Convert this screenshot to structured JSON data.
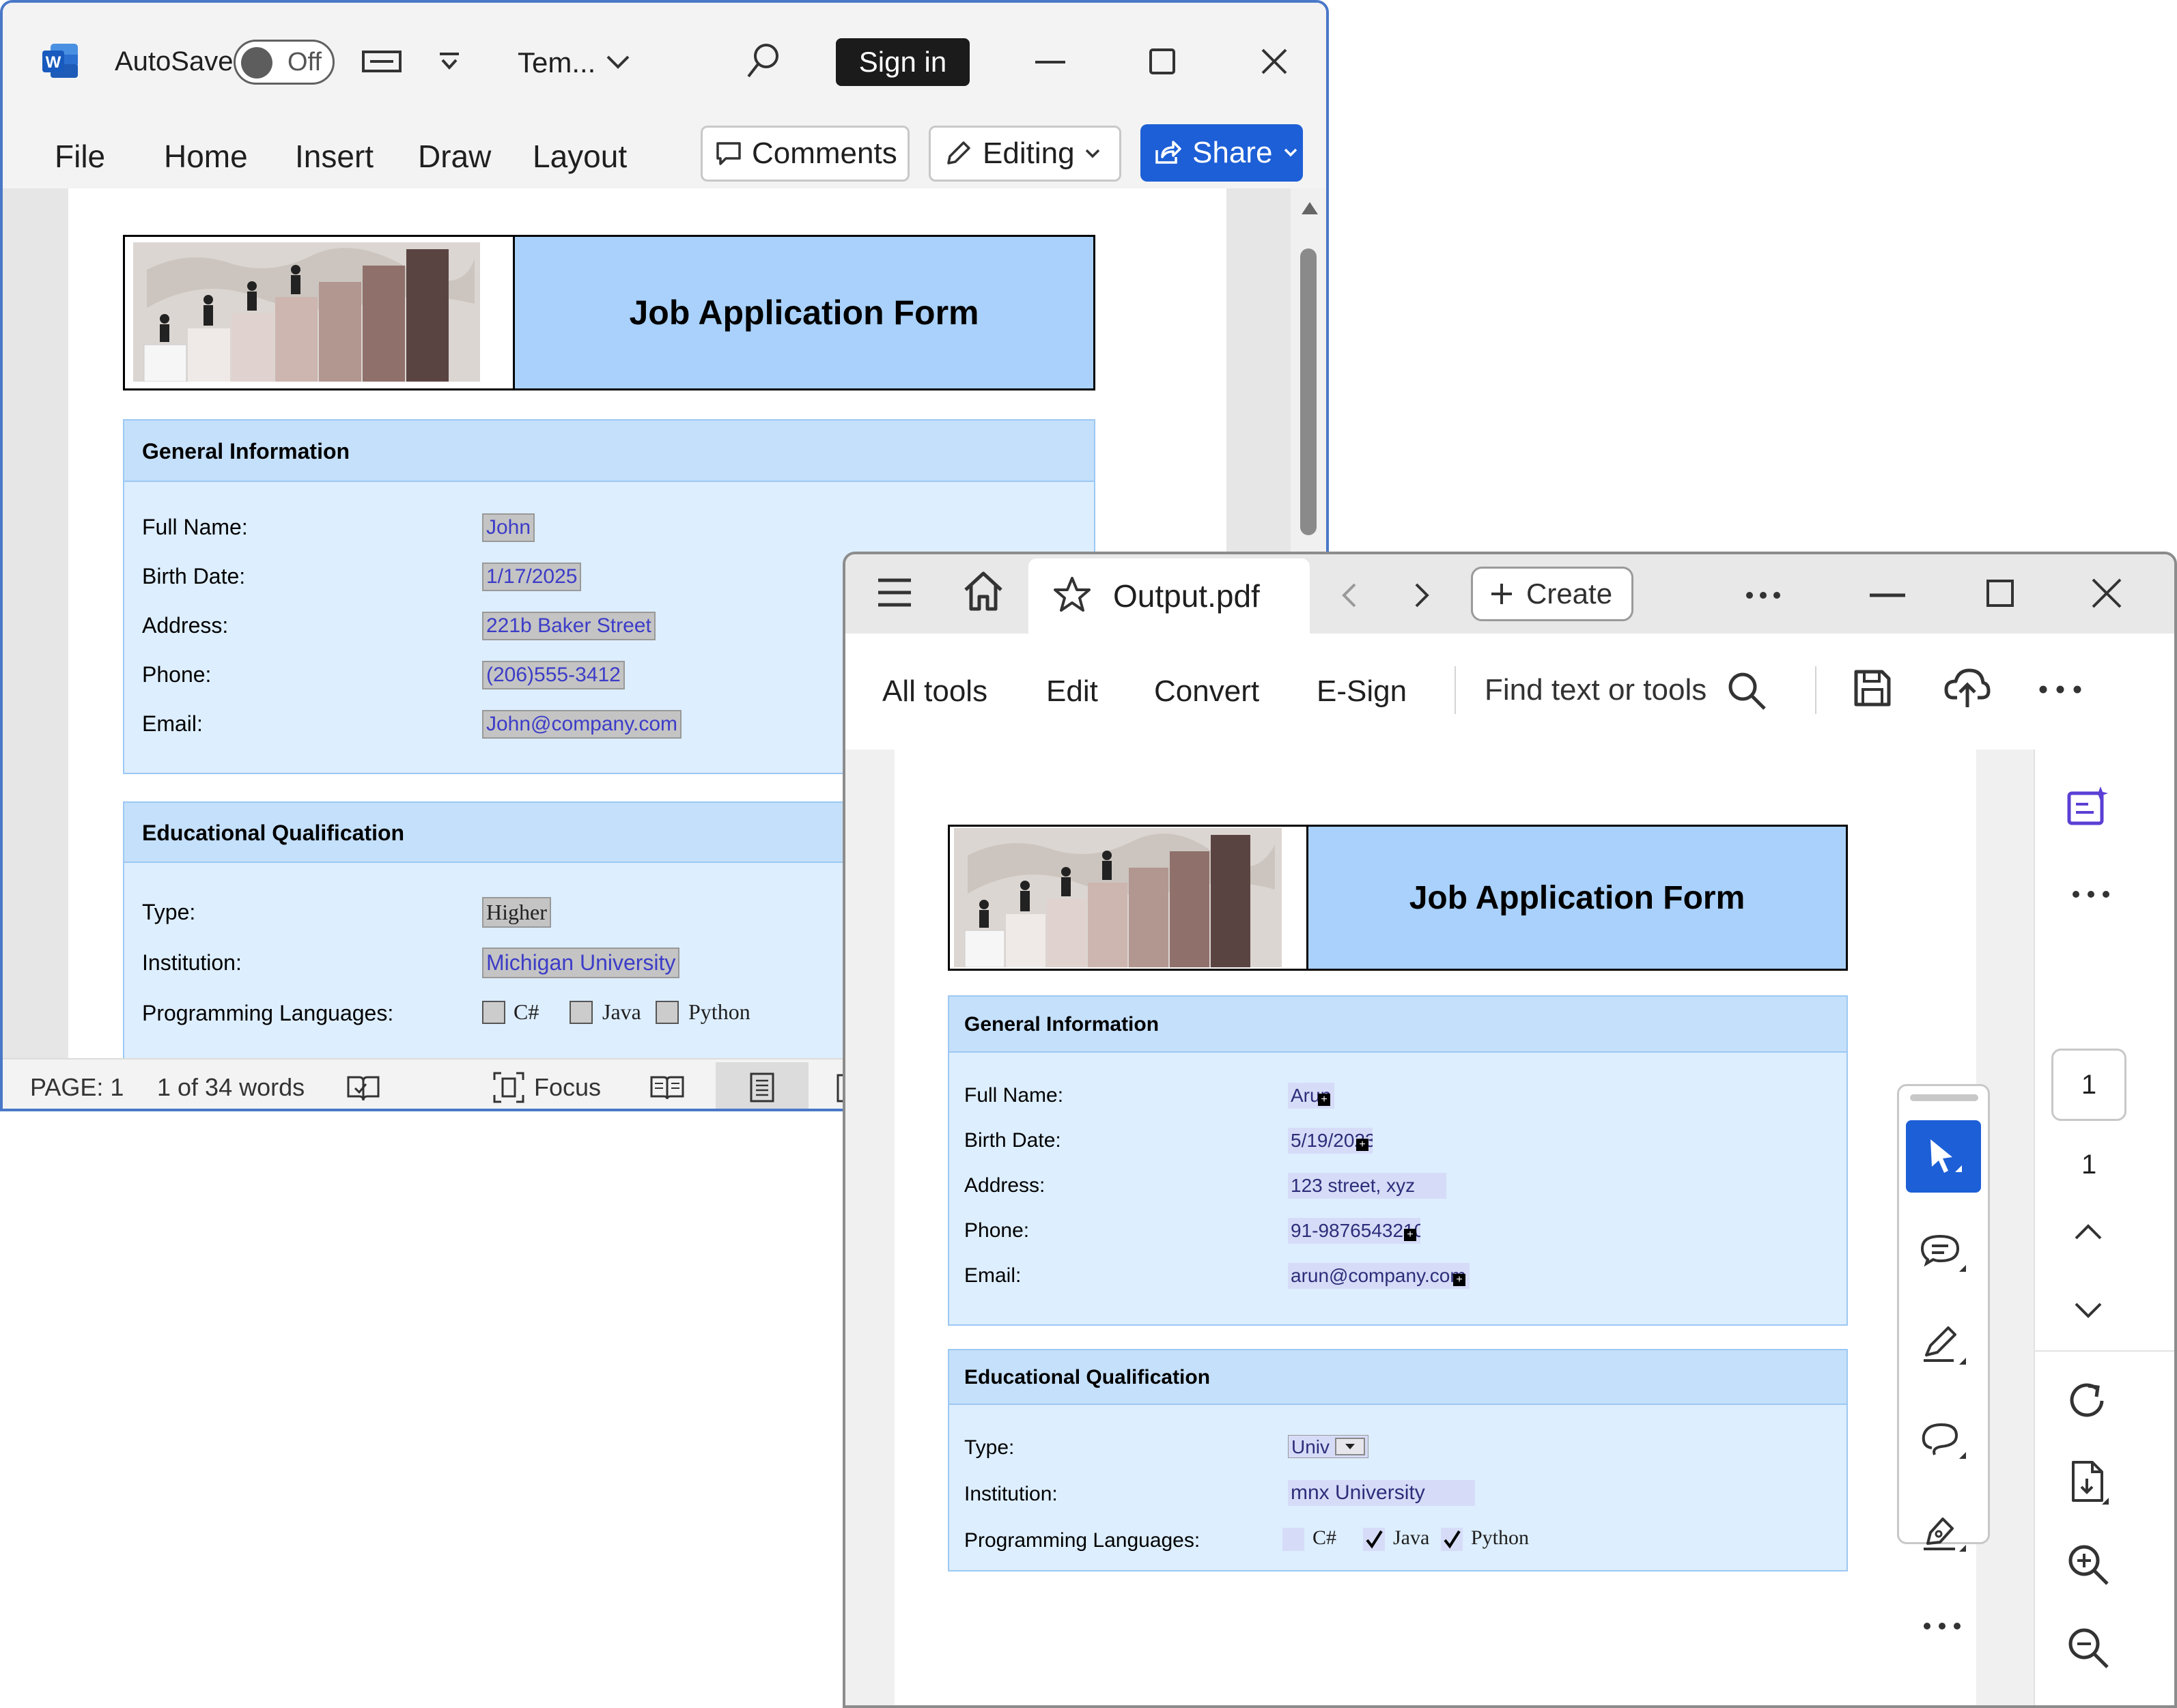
{
  "word": {
    "autosave_label": "AutoSave",
    "autosave_state": "Off",
    "doc_title": "Tem...",
    "signin_label": "Sign in",
    "menu": [
      "File",
      "Home",
      "Insert",
      "Draw",
      "Layout"
    ],
    "comments_label": "Comments",
    "editing_label": "Editing",
    "share_label": "Share",
    "status": {
      "page": "PAGE: 1",
      "words": "1 of 34 words",
      "focus": "Focus"
    },
    "form": {
      "title": "Job Application Form",
      "general_header": "General Information",
      "fields": [
        {
          "label": "Full Name:",
          "value": "John"
        },
        {
          "label": "Birth Date:",
          "value": "1/17/2025"
        },
        {
          "label": "Address:",
          "value": "221b Baker Street"
        },
        {
          "label": "Phone:",
          "value": "(206)555-3412"
        },
        {
          "label": "Email:",
          "value": "John@company.com"
        }
      ],
      "edu_header": "Educational Qualification",
      "type_label": "Type:",
      "type_value": "Higher",
      "institution_label": "Institution:",
      "institution_value": "Michigan University",
      "languages_label": "Programming Languages:",
      "languages": [
        "C#",
        "Java",
        "Python"
      ]
    }
  },
  "pdf": {
    "tab_title": "Output.pdf",
    "create_label": "Create",
    "tools": [
      "All tools",
      "Edit",
      "Convert",
      "E-Sign"
    ],
    "find_placeholder": "Find text or tools",
    "page_current": "1",
    "page_total": "1",
    "form": {
      "title": "Job Application Form",
      "general_header": "General Information",
      "fields": [
        {
          "label": "Full Name:",
          "value": "Arun"
        },
        {
          "label": "Birth Date:",
          "value": "5/19/2023"
        },
        {
          "label": "Address:",
          "value": "123 street, xyz"
        },
        {
          "label": "Phone:",
          "value": "91-9876543210"
        },
        {
          "label": "Email:",
          "value": "arun@company.com"
        }
      ],
      "edu_header": "Educational Qualification",
      "type_label": "Type:",
      "type_value": "Univ",
      "institution_label": "Institution:",
      "institution_value": "mnx University",
      "languages_label": "Programming Languages:",
      "languages": [
        {
          "name": "C#",
          "checked": false
        },
        {
          "name": "Java",
          "checked": true
        },
        {
          "name": "Python",
          "checked": true
        }
      ]
    }
  }
}
